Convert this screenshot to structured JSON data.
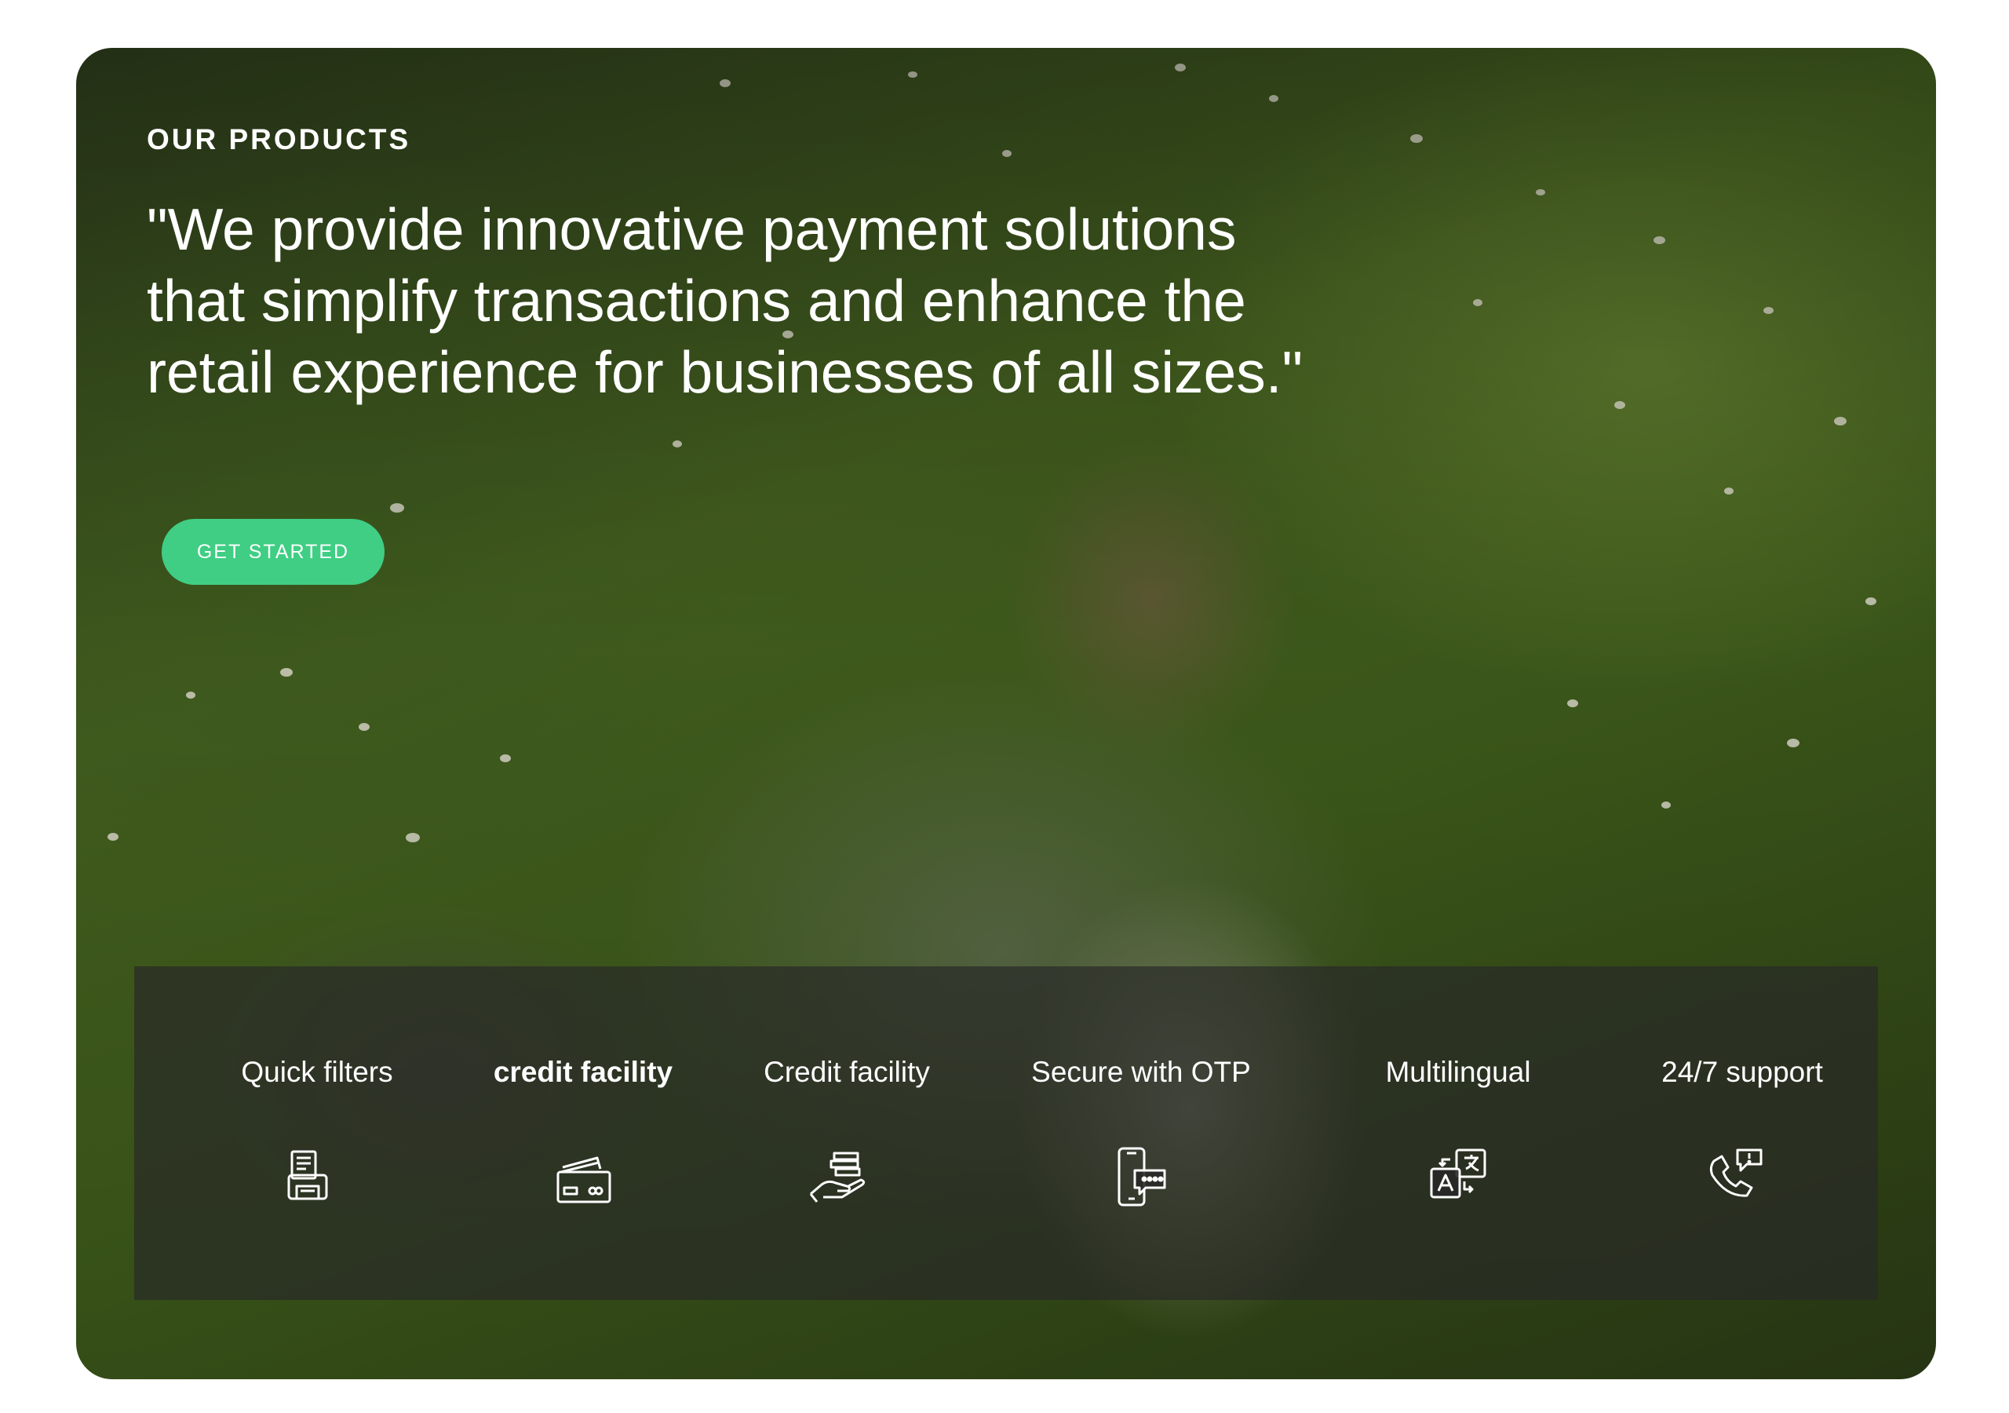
{
  "hero": {
    "eyebrow": "OUR PRODUCTS",
    "quote": "\"We provide innovative payment solutions that simplify transactions and enhance the retail experience for businesses of all sizes.\"",
    "cta_label": "GET STARTED",
    "cta_color": "#3fce83"
  },
  "features": [
    {
      "label": "Quick filters",
      "icon": "receipt-printer-icon"
    },
    {
      "label": "credit facility",
      "icon": "credit-card-icon",
      "active": true
    },
    {
      "label": "Credit facility",
      "icon": "cash-in-hand-icon"
    },
    {
      "label": "Secure with OTP",
      "icon": "phone-chat-icon"
    },
    {
      "label": "Multilingual",
      "icon": "translate-icon"
    },
    {
      "label": "24/7 support",
      "icon": "phone-support-icon"
    }
  ]
}
